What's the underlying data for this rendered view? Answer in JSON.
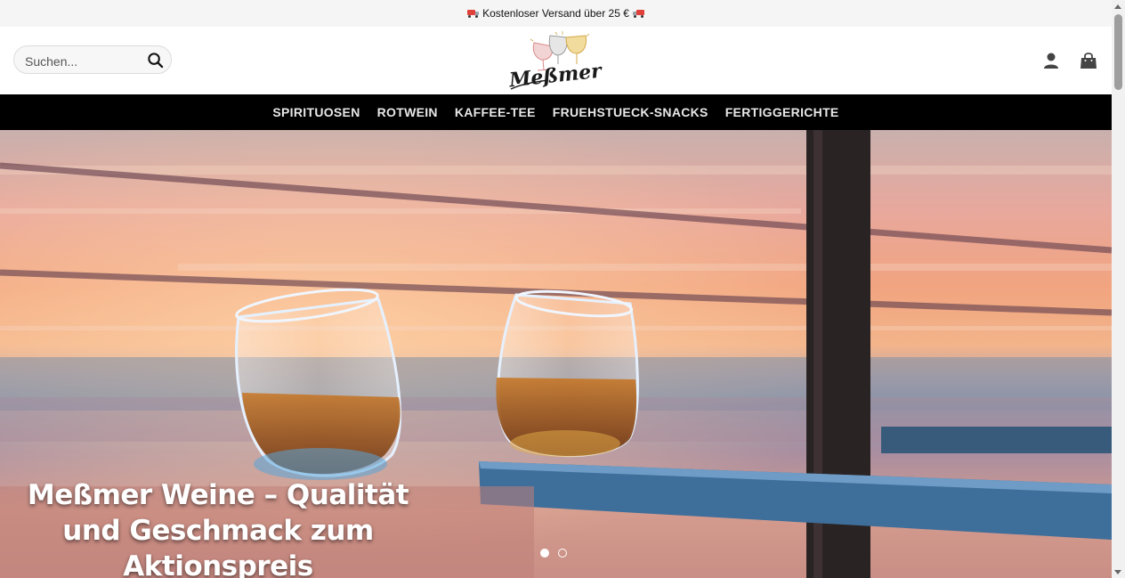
{
  "announcement": {
    "text": "Kostenloser Versand über 25 €",
    "icon": "truck-icon"
  },
  "header": {
    "search": {
      "placeholder": "Suchen...",
      "value": ""
    },
    "logo_text": "Meßmer",
    "icons": [
      "user-icon",
      "shopping-bag-icon",
      "search-icon"
    ]
  },
  "nav": {
    "items": [
      {
        "label": "SPIRITUOSEN"
      },
      {
        "label": "ROTWEIN"
      },
      {
        "label": "KAFFEE-TEE"
      },
      {
        "label": "FRUEHSTUECK-SNACKS"
      },
      {
        "label": "FERTIGGERICHTE"
      }
    ]
  },
  "hero": {
    "title": "Meßmer Weine – Qualität und Geschmack zum Aktionspreis",
    "slides": 2,
    "active_slide": 1
  },
  "colors": {
    "nav_bg": "#000000",
    "topbar_bg": "#f5f5f5",
    "nav_text": "#e8e8e8"
  }
}
